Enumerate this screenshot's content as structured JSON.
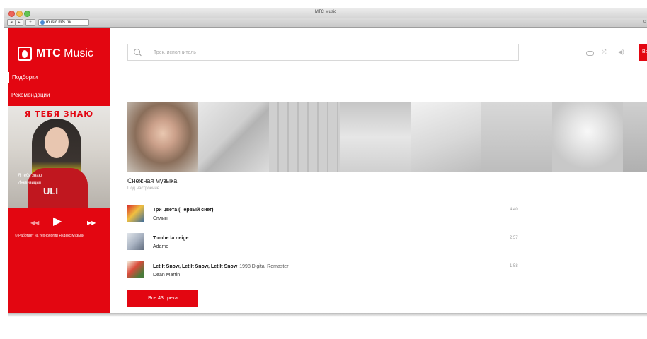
{
  "window": {
    "title": "MTC Music",
    "url": "music.mts.ru/",
    "toolbar_right": "c"
  },
  "sidebar": {
    "logo_bold": "МТС",
    "logo_rest": "Music",
    "nav": [
      {
        "label": "Подборки"
      },
      {
        "label": "Рекомендации"
      }
    ],
    "cover": {
      "title": "Я ТЕБЯ ЗНАЮ",
      "shirt_text": "ULI"
    },
    "now_playing": {
      "track": "Я тебя знаю",
      "artist": "Инквизиция"
    },
    "powered": "© Работает на технологии Яндекс.Музыки"
  },
  "search": {
    "placeholder": "Трек, исполнитель",
    "value": ""
  },
  "header": {
    "login_label": "Во"
  },
  "playlist": {
    "title": "Снежная музыка",
    "subtitle": "Под настроение",
    "tracks": [
      {
        "name": "Три цвета (Первый снег)",
        "version": "",
        "artist": "Сплин",
        "duration": "4:40"
      },
      {
        "name": "Tombe la neige",
        "version": "",
        "artist": "Adamo",
        "duration": "2:57"
      },
      {
        "name": "Let It Snow, Let It Snow, Let It Snow",
        "version": "1998 Digital Remaster",
        "artist": "Dean Martin",
        "duration": "1:58"
      }
    ],
    "all_tracks_label": "Все 43 трека"
  },
  "colors": {
    "brand_red": "#e30611",
    "text_dark": "#222222",
    "text_muted": "#999999"
  },
  "icons": {
    "controls": [
      "prev-icon",
      "play-icon",
      "next-icon"
    ],
    "header": [
      "search-icon",
      "repeat-icon",
      "shuffle-icon",
      "volume-icon"
    ]
  }
}
